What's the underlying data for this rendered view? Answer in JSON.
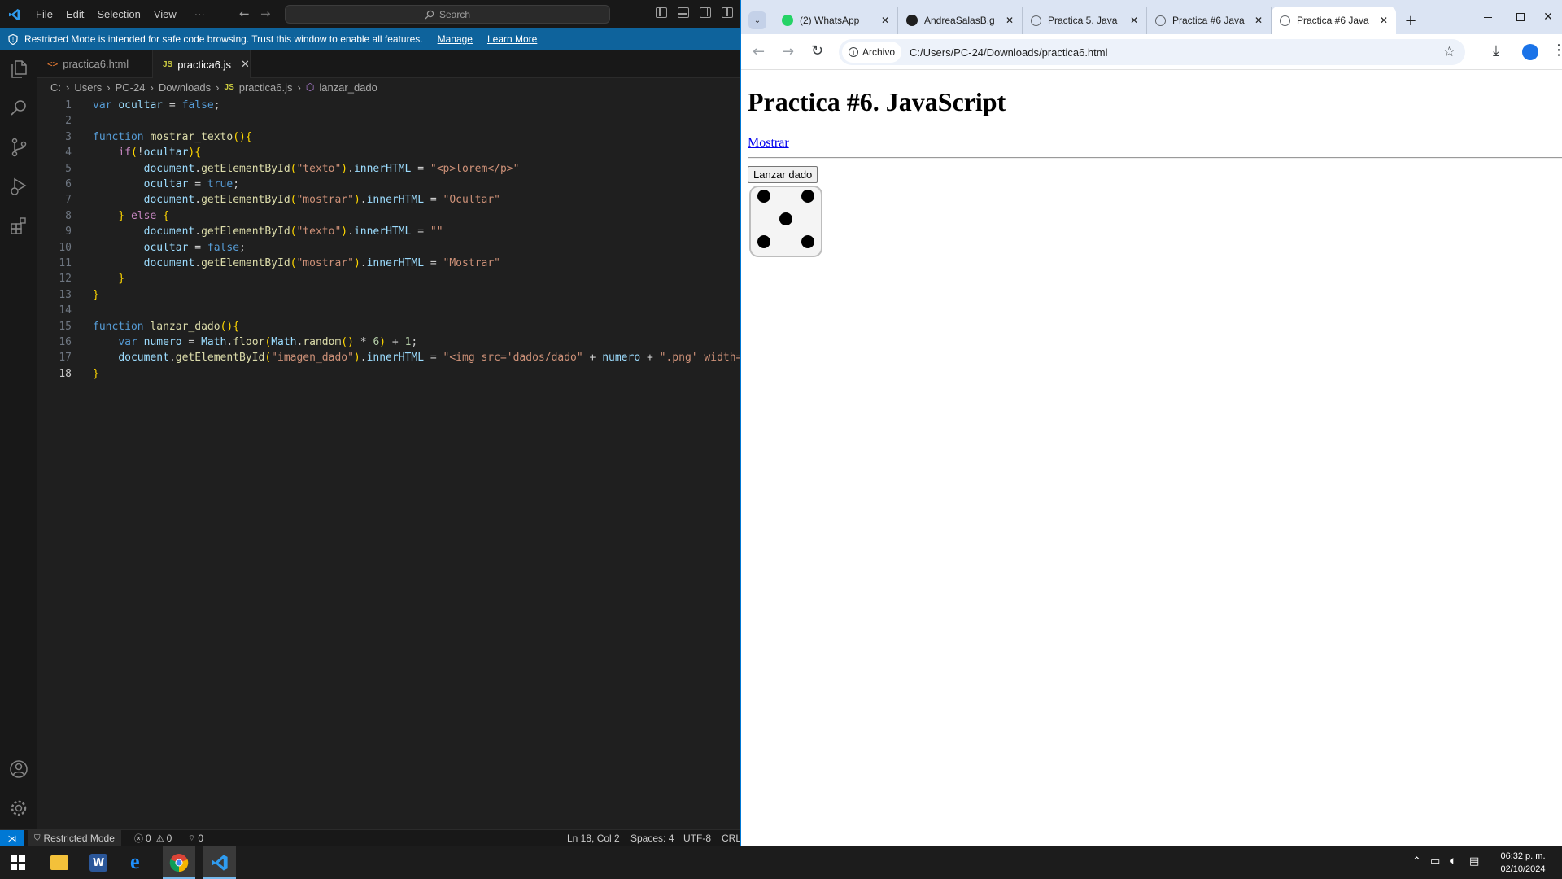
{
  "vscode": {
    "menu": [
      "File",
      "Edit",
      "Selection",
      "View",
      "···"
    ],
    "search_label": "Search",
    "banner": {
      "text": "Restricted Mode is intended for safe code browsing. Trust this window to enable all features.",
      "manage": "Manage",
      "learn_more": "Learn More"
    },
    "tabs": [
      {
        "label": "practica6.html",
        "icon": "html-file-icon"
      },
      {
        "label": "practica6.js",
        "icon": "js-file-icon"
      }
    ],
    "breadcrumb": [
      "C:",
      "Users",
      "PC-24",
      "Downloads",
      "practica6.js",
      "lanzar_dado"
    ],
    "code_lines": [
      "var ocultar = false;",
      "",
      "function mostrar_texto(){",
      "    if(!ocultar){",
      "        document.getElementById(\"texto\").innerHTML = \"<p>lorem</p>\"",
      "        ocultar = true;",
      "        document.getElementById(\"mostrar\").innerHTML = \"Ocultar\"",
      "    } else {",
      "        document.getElementById(\"texto\").innerHTML = \"\"",
      "        ocultar = false;",
      "        document.getElementById(\"mostrar\").innerHTML = \"Mostrar\"",
      "    }",
      "}",
      "",
      "function lanzar_dado(){",
      "    var numero = Math.floor(Math.random() * 6) + 1;",
      "    document.getElementById(\"imagen_dado\").innerHTML = \"<img src='dados/dado\" + numero + \".png' width='",
      "}"
    ],
    "status": {
      "mode": "Restricted Mode",
      "errors": "0",
      "warnings": "0",
      "ports": "0",
      "position": "Ln 18, Col 2",
      "spaces": "Spaces: 4",
      "encoding": "UTF-8",
      "eol": "CRL"
    }
  },
  "browser": {
    "tabs": [
      {
        "label": "(2) WhatsApp",
        "icon": "whatsapp-icon"
      },
      {
        "label": "AndreaSalasB.g",
        "icon": "github-icon"
      },
      {
        "label": "Practica 5. Java",
        "icon": "globe-icon"
      },
      {
        "label": "Practica #6 Java",
        "icon": "globe-icon"
      },
      {
        "label": "Practica #6 Java",
        "icon": "globe-icon"
      }
    ],
    "security_chip": "Archivo",
    "url": "C:/Users/PC-24/Downloads/practica6.html",
    "page": {
      "heading": "Practica #6. JavaScript",
      "link": "Mostrar",
      "button": "Lanzar dado",
      "dice_value": 5
    }
  },
  "taskbar": {
    "time": "06:32 p. m.",
    "date": "02/10/2024",
    "apps": [
      "windows-start-icon",
      "file-explorer-icon",
      "word-icon",
      "edge-icon",
      "chrome-icon",
      "vscode-icon"
    ]
  }
}
